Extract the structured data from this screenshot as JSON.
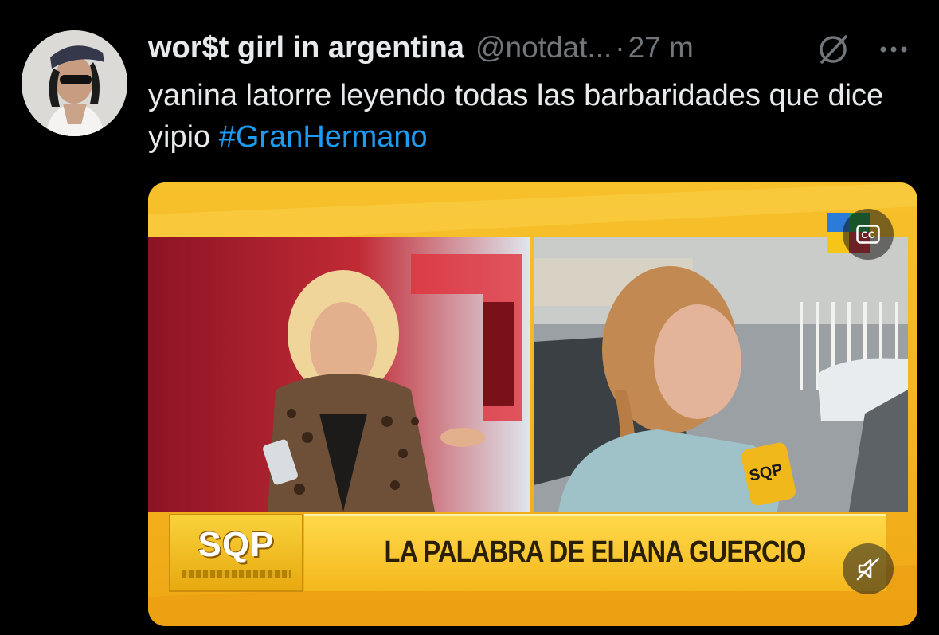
{
  "tweet": {
    "display_name": "wor$t girl in argentina",
    "handle": "@notdat...",
    "separator": "·",
    "time": "27 m",
    "text_before": "yanina latorre leyendo todas las barbaridades que dice yipio ",
    "hashtag": "#GranHermano"
  },
  "media": {
    "show_logo": "SQP",
    "caption": "LA PALABRA DE ELIANA GUERCIO",
    "mic_logo": "SQP",
    "cc_label": "CC"
  },
  "icons": {
    "grok": "grok-icon",
    "more": "more-icon",
    "cc": "closed-captions-icon",
    "mute": "speaker-muted-icon"
  },
  "colors": {
    "background": "#000000",
    "text": "#e7e9ea",
    "secondary": "#71767b",
    "link": "#1d9bf0",
    "broadcast_yellow": "#f5b21a"
  }
}
